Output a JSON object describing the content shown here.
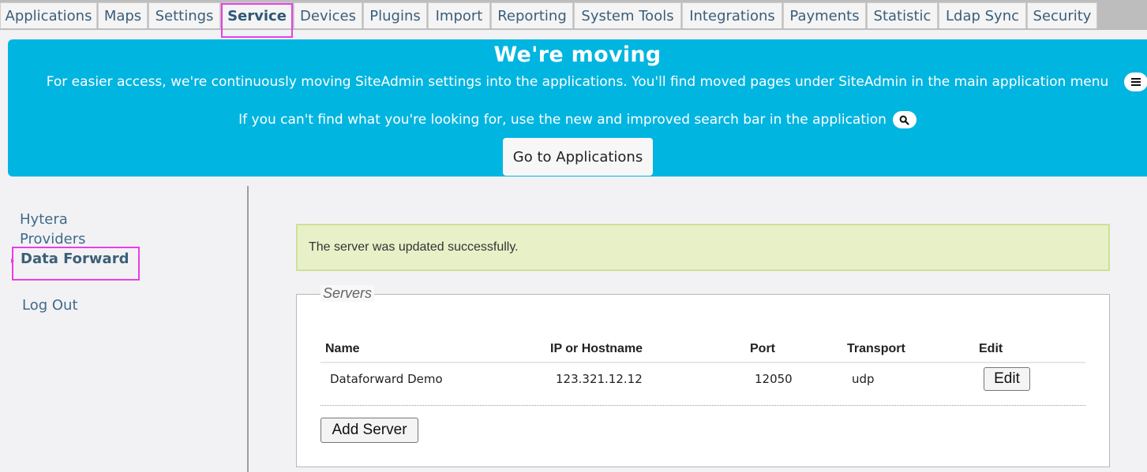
{
  "tabs": [
    {
      "label": "Applications",
      "active": false
    },
    {
      "label": "Maps",
      "active": false
    },
    {
      "label": "Settings",
      "active": false
    },
    {
      "label": "Service",
      "active": true
    },
    {
      "label": "Devices",
      "active": false
    },
    {
      "label": "Plugins",
      "active": false
    },
    {
      "label": "Import",
      "active": false
    },
    {
      "label": "Reporting",
      "active": false
    },
    {
      "label": "System Tools",
      "active": false
    },
    {
      "label": "Integrations",
      "active": false
    },
    {
      "label": "Payments",
      "active": false
    },
    {
      "label": "Statistic",
      "active": false
    },
    {
      "label": "Ldap Sync",
      "active": false
    },
    {
      "label": "Security",
      "active": false
    }
  ],
  "banner": {
    "title": "We're moving",
    "line1": "For easier access, we're continuously moving SiteAdmin settings into the applications. You'll find moved pages under SiteAdmin in the main application menu",
    "line2": "If you can't find what you're looking for, use the new and improved search bar in the application",
    "button": "Go to Applications",
    "search_icon": "search-icon",
    "menu_icon": "hamburger-menu-icon",
    "color": "#00b5e0"
  },
  "sidebar": {
    "items": [
      {
        "label": "Hytera",
        "active": false
      },
      {
        "label": "Providers",
        "active": false
      },
      {
        "label": "Data Forward",
        "active": true
      },
      {
        "label": "Log Out",
        "active": false
      }
    ]
  },
  "message": "The server was updated successfully.",
  "servers": {
    "legend": "Servers",
    "columns": [
      "Name",
      "IP or Hostname",
      "Port",
      "Transport",
      "Edit"
    ],
    "rows": [
      {
        "name": "Dataforward Demo",
        "host": "123.321.12.12",
        "port": "12050",
        "transport": "udp",
        "edit": "Edit"
      }
    ],
    "add_button": "Add Server"
  },
  "colors": {
    "highlight": "#e83ee8",
    "success_bg": "#e8f0c8"
  }
}
